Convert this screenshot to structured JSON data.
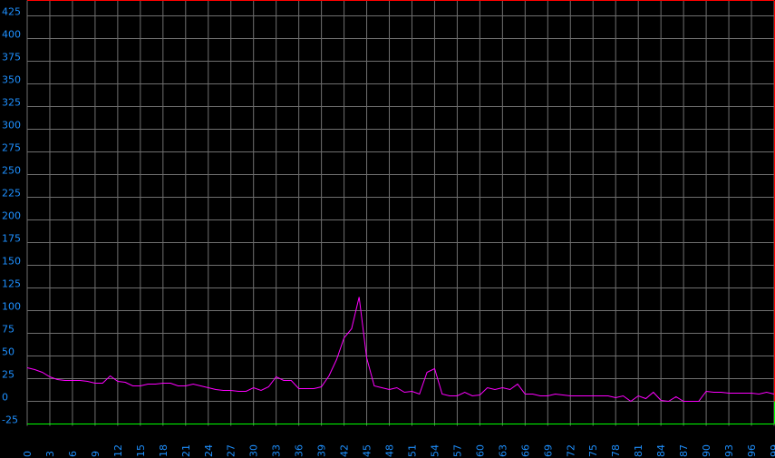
{
  "chart_data": {
    "type": "line",
    "title": "",
    "xlabel": "",
    "ylabel": "",
    "xlim": [
      0,
      99
    ],
    "ylim": [
      -25,
      440
    ],
    "yticks": [
      -25,
      0,
      25,
      50,
      75,
      100,
      125,
      150,
      175,
      200,
      225,
      250,
      275,
      300,
      325,
      350,
      375,
      400,
      425
    ],
    "xticks": [
      0,
      3,
      6,
      9,
      12,
      15,
      18,
      21,
      24,
      27,
      30,
      33,
      36,
      39,
      42,
      45,
      48,
      51,
      54,
      57,
      60,
      63,
      66,
      69,
      72,
      75,
      78,
      81,
      84,
      87,
      90,
      93,
      96,
      99
    ],
    "grid": true,
    "colors": {
      "background": "#000000",
      "grid": "#6f6f6f",
      "tick_labels": "#1e90ff",
      "series": "#ff00ff",
      "upper_frame": "#ff0000",
      "lower_frame": "#00ff00"
    },
    "series": [
      {
        "color": "#ff00ff",
        "x": [
          0,
          1,
          2,
          3,
          4,
          5,
          6,
          7,
          8,
          9,
          10,
          11,
          12,
          13,
          14,
          15,
          16,
          17,
          18,
          19,
          20,
          21,
          22,
          23,
          24,
          25,
          26,
          27,
          28,
          29,
          30,
          31,
          32,
          33,
          34,
          35,
          36,
          37,
          38,
          39,
          40,
          41,
          42,
          43,
          44,
          45,
          46,
          47,
          48,
          49,
          50,
          51,
          52,
          53,
          54,
          55,
          56,
          57,
          58,
          59,
          60,
          61,
          62,
          63,
          64,
          65,
          66,
          67,
          68,
          69,
          70,
          71,
          72,
          73,
          74,
          75,
          76,
          77,
          78,
          79,
          80,
          81,
          82,
          83,
          84,
          85,
          86,
          87,
          88,
          89,
          90,
          91,
          92,
          93,
          94,
          95,
          96,
          97,
          98,
          99
        ],
        "values": [
          37,
          35,
          32,
          27,
          24,
          23,
          23,
          23,
          22,
          20,
          20,
          28,
          22,
          21,
          17,
          17,
          19,
          19,
          20,
          20,
          17,
          17,
          19,
          17,
          15,
          13,
          12,
          12,
          11,
          11,
          15,
          12,
          16,
          27,
          23,
          23,
          14,
          14,
          14,
          16,
          28,
          46,
          70,
          80,
          115,
          48,
          17,
          15,
          13,
          15,
          10,
          11,
          8,
          32,
          36,
          8,
          6,
          6,
          10,
          6,
          7,
          15,
          13,
          15,
          13,
          19,
          8,
          8,
          6,
          6,
          8,
          7,
          6,
          6,
          6,
          6,
          6,
          6,
          4,
          6,
          0,
          6,
          3,
          10,
          1,
          0,
          5,
          0,
          0,
          0,
          11,
          10,
          10,
          9,
          9,
          9,
          9,
          8,
          10,
          8
        ]
      }
    ]
  }
}
